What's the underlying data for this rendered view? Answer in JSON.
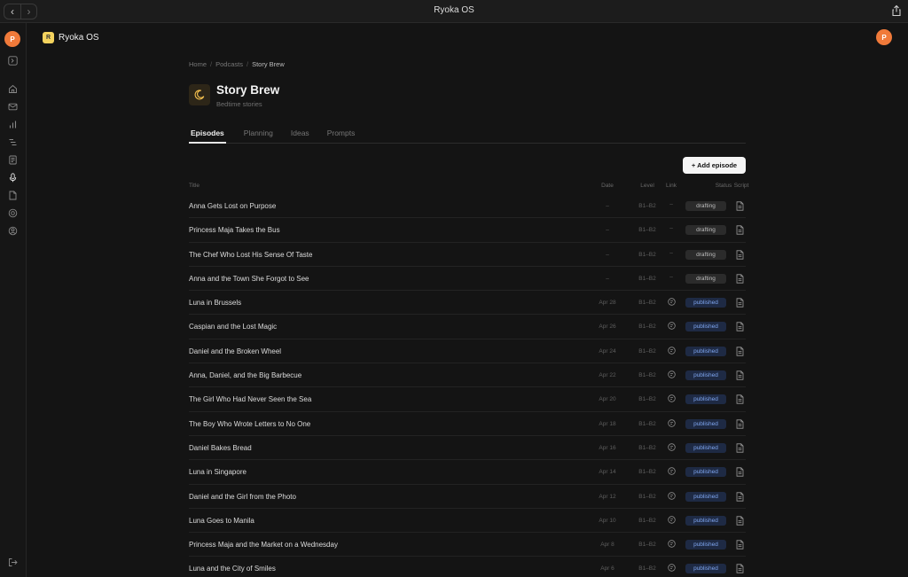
{
  "window": {
    "title": "Ryoka OS"
  },
  "user": {
    "initial": "P"
  },
  "app": {
    "badge": "R",
    "name": "Ryoka OS"
  },
  "sidebar": {
    "icons": [
      "panel-toggle-icon",
      "home-icon",
      "mail-icon",
      "bar-chart-icon",
      "list-icon",
      "notes-icon",
      "microphone-icon",
      "document-icon",
      "settings-icon",
      "user-circle-icon"
    ],
    "bottom_icon": "logout-icon"
  },
  "breadcrumb": {
    "items": [
      "Home",
      "Podcasts",
      "Story Brew"
    ],
    "separator": "/"
  },
  "podcast": {
    "title": "Story Brew",
    "subtitle": "Bedtime stories",
    "icon": "moon-icon"
  },
  "tabs": [
    {
      "label": "Episodes",
      "active": true
    },
    {
      "label": "Planning",
      "active": false
    },
    {
      "label": "Ideas",
      "active": false
    },
    {
      "label": "Prompts",
      "active": false
    }
  ],
  "add_button": {
    "label": "+ Add episode"
  },
  "table": {
    "columns": {
      "title": "Title",
      "date": "Date",
      "level": "Level",
      "link": "Link",
      "status": "Status",
      "script": "Script"
    },
    "rows": [
      {
        "title": "Anna Gets Lost on Purpose",
        "date": "–",
        "level": "B1–B2",
        "link": "–",
        "status": "drafting"
      },
      {
        "title": "Princess Maja Takes the Bus",
        "date": "–",
        "level": "B1–B2",
        "link": "–",
        "status": "drafting"
      },
      {
        "title": "The Chef Who Lost His Sense Of Taste",
        "date": "–",
        "level": "B1–B2",
        "link": "–",
        "status": "drafting"
      },
      {
        "title": "Anna and the Town She Forgot to See",
        "date": "–",
        "level": "B1–B2",
        "link": "–",
        "status": "drafting"
      },
      {
        "title": "Luna in Brussels",
        "date": "Apr 28",
        "level": "B1–B2",
        "link": "icon",
        "status": "published"
      },
      {
        "title": "Caspian and the Lost Magic",
        "date": "Apr 26",
        "level": "B1–B2",
        "link": "icon",
        "status": "published"
      },
      {
        "title": "Daniel and the Broken Wheel",
        "date": "Apr 24",
        "level": "B1–B2",
        "link": "icon",
        "status": "published"
      },
      {
        "title": "Anna, Daniel, and the Big Barbecue",
        "date": "Apr 22",
        "level": "B1–B2",
        "link": "icon",
        "status": "published"
      },
      {
        "title": "The Girl Who Had Never Seen the Sea",
        "date": "Apr 20",
        "level": "B1–B2",
        "link": "icon",
        "status": "published"
      },
      {
        "title": "The Boy Who Wrote Letters to No One",
        "date": "Apr 18",
        "level": "B1–B2",
        "link": "icon",
        "status": "published"
      },
      {
        "title": "Daniel Bakes Bread",
        "date": "Apr 16",
        "level": "B1–B2",
        "link": "icon",
        "status": "published"
      },
      {
        "title": "Luna in Singapore",
        "date": "Apr 14",
        "level": "B1–B2",
        "link": "icon",
        "status": "published"
      },
      {
        "title": "Daniel and the Girl from the Photo",
        "date": "Apr 12",
        "level": "B1–B2",
        "link": "icon",
        "status": "published"
      },
      {
        "title": "Luna Goes to Manila",
        "date": "Apr 10",
        "level": "B1–B2",
        "link": "icon",
        "status": "published"
      },
      {
        "title": "Princess Maja and the Market on a Wednesday",
        "date": "Apr 8",
        "level": "B1–B2",
        "link": "icon",
        "status": "published"
      },
      {
        "title": "Luna and the City of Smiles",
        "date": "Apr 6",
        "level": "B1–B2",
        "link": "icon",
        "status": "published"
      }
    ]
  },
  "colors": {
    "background": "#141414",
    "accent_avatar": "#f07a3a",
    "app_badge": "#f4d35e",
    "published_badge_bg": "#1e2a44",
    "published_badge_text": "#7fa6f0",
    "drafting_badge_bg": "#2b2b2b"
  }
}
